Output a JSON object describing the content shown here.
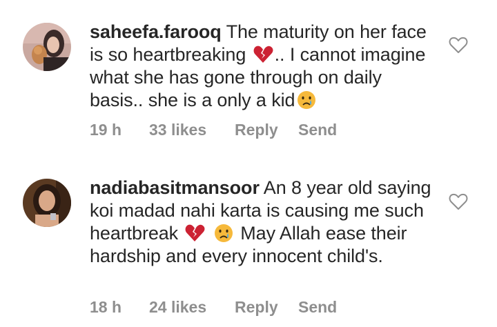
{
  "comments": [
    {
      "username": "saheefa.farooq",
      "segments": [
        " The maturity on her face is so heartbreaking ",
        ".. I cannot imagine what she has gone through on daily basis.. she is a only a kid"
      ],
      "emojis": [
        "broken-heart-icon",
        "crying-face-icon"
      ],
      "time": "19 h",
      "likes": "33 likes",
      "reply": "Reply",
      "send": "Send"
    },
    {
      "username": "nadiabasitmansoor",
      "segments": [
        " An 8 year old saying koi madad nahi karta is causing me such heartbreak ",
        " May Allah ease their hardship and every innocent child's."
      ],
      "emojis": [
        "broken-heart-icon",
        "crying-face-icon"
      ],
      "time": "18 h",
      "likes": "24 likes",
      "reply": "Reply",
      "send": "Send"
    }
  ],
  "colors": {
    "text": "#262626",
    "meta": "#8e8e8e",
    "heart": "#cc2233",
    "emoji_face": "#f6b93b"
  }
}
